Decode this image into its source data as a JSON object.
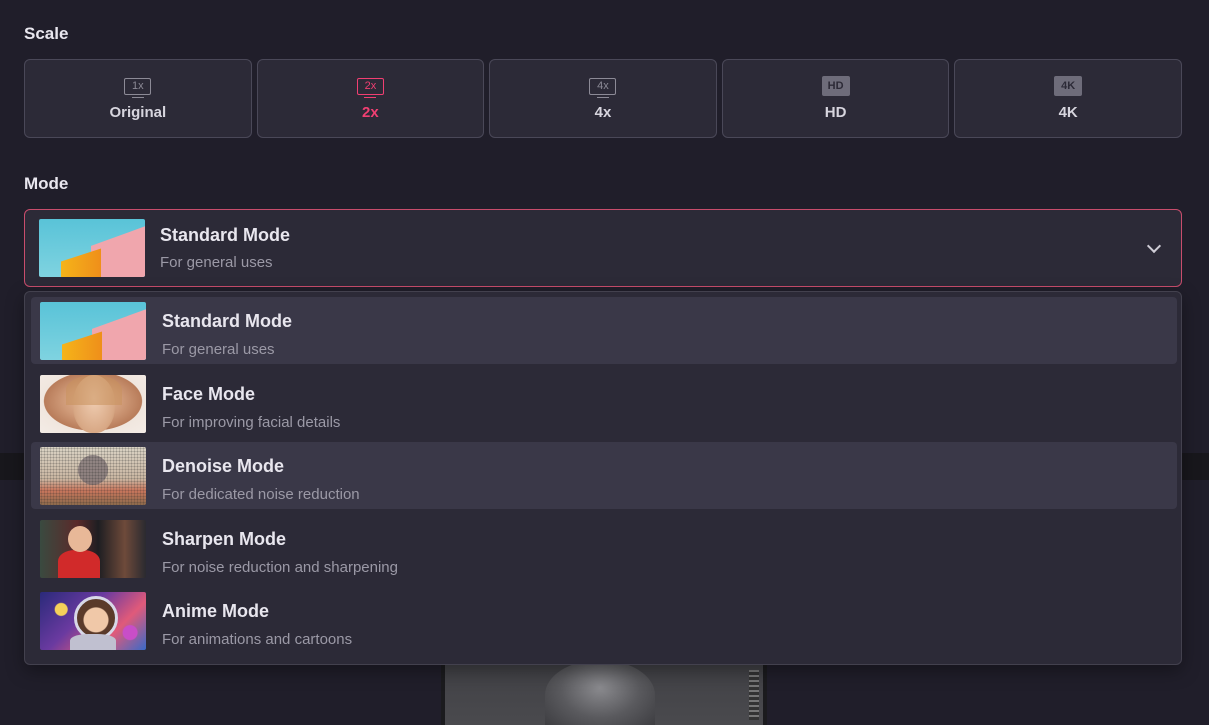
{
  "scale": {
    "label": "Scale",
    "options": [
      {
        "label": "Original",
        "icon_text": "1x",
        "icon": "scale-1x-icon",
        "active": false
      },
      {
        "label": "2x",
        "icon_text": "2x",
        "icon": "scale-2x-icon",
        "active": true
      },
      {
        "label": "4x",
        "icon_text": "4x",
        "icon": "scale-4x-icon",
        "active": false
      },
      {
        "label": "HD",
        "icon_text": "HD",
        "icon": "hd-icon",
        "active": false
      },
      {
        "label": "4K",
        "icon_text": "4K",
        "icon": "4k-icon",
        "active": false
      }
    ]
  },
  "mode": {
    "label": "Mode",
    "selected": {
      "title": "Standard Mode",
      "desc": "For general uses"
    },
    "options": [
      {
        "title": "Standard Mode",
        "desc": "For general uses",
        "highlighted": true
      },
      {
        "title": "Face Mode",
        "desc": "For improving facial details",
        "highlighted": false
      },
      {
        "title": "Denoise Mode",
        "desc": "For dedicated noise reduction",
        "highlighted": true
      },
      {
        "title": "Sharpen Mode",
        "desc": "For noise reduction and sharpening",
        "highlighted": false
      },
      {
        "title": "Anime Mode",
        "desc": "For animations and cartoons",
        "highlighted": false
      }
    ]
  },
  "colors": {
    "background": "#201e2a",
    "card": "#2c2a37",
    "accent": "#f03f72",
    "select_border": "#c84d6c"
  }
}
